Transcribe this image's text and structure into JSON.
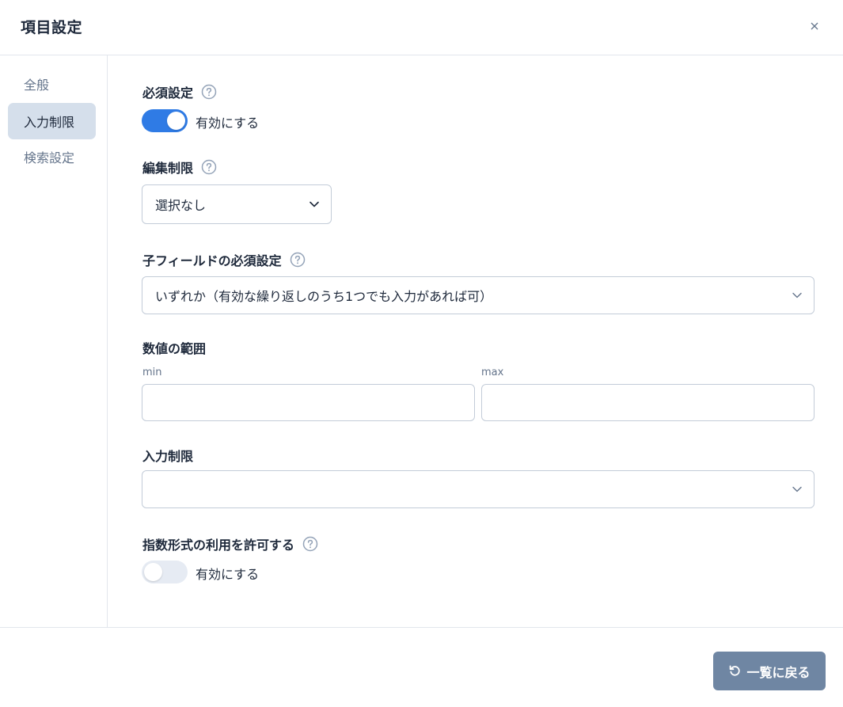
{
  "header": {
    "title": "項目設定"
  },
  "sidebar": {
    "items": [
      {
        "label": "全般",
        "active": false
      },
      {
        "label": "入力制限",
        "active": true
      },
      {
        "label": "検索設定",
        "active": false
      }
    ]
  },
  "required": {
    "label": "必須設定",
    "toggle_label": "有効にする",
    "enabled": true
  },
  "edit_restriction": {
    "label": "編集制限",
    "value": "選択なし"
  },
  "child_required": {
    "label": "子フィールドの必須設定",
    "value": "いずれか（有効な繰り返しのうち1つでも入力があれば可）"
  },
  "range": {
    "label": "数値の範囲",
    "min_label": "min",
    "max_label": "max",
    "min_value": "",
    "max_value": ""
  },
  "input_restriction": {
    "label": "入力制限",
    "value": ""
  },
  "exponent": {
    "label": "指数形式の利用を許可する",
    "toggle_label": "有効にする",
    "enabled": false
  },
  "footer": {
    "back_label": "一覧に戻る"
  },
  "colors": {
    "accent": "#2f7be5",
    "button": "#6f86a3",
    "active_nav": "#d5dfeb"
  },
  "icons": {
    "close": "close-icon",
    "help": "help-circle-icon",
    "chevron": "chevron-down-icon",
    "undo": "undo-icon"
  }
}
